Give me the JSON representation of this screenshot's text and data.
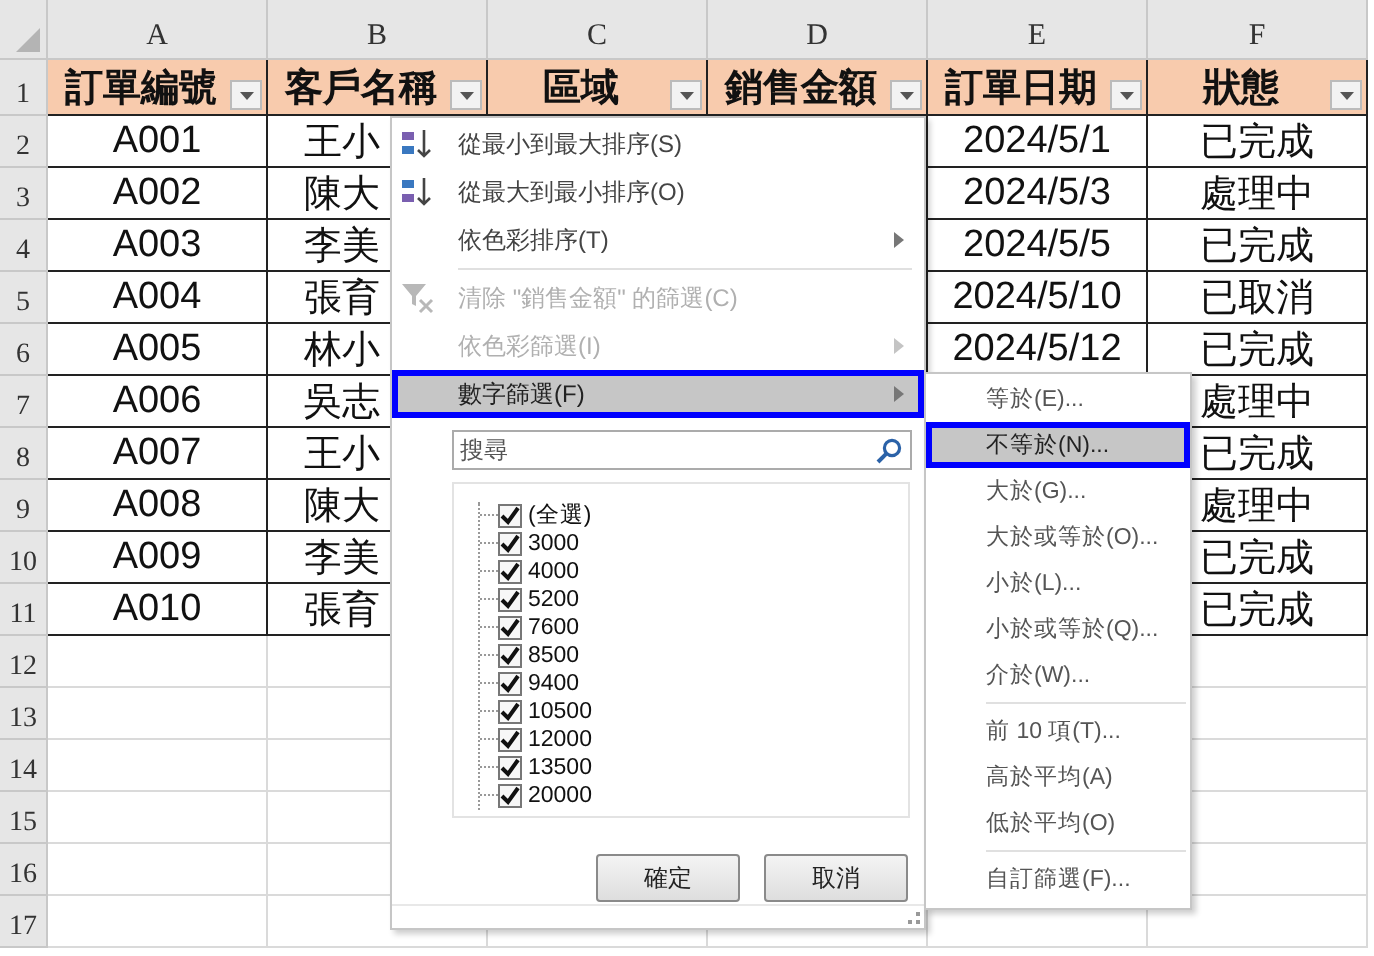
{
  "sheet": {
    "column_headers": [
      "A",
      "B",
      "C",
      "D",
      "E",
      "F"
    ],
    "row_headers": [
      "1",
      "2",
      "3",
      "4",
      "5",
      "6",
      "7",
      "8",
      "9",
      "10",
      "11",
      "12",
      "13",
      "14",
      "15",
      "16",
      "17"
    ],
    "fields": [
      {
        "label": "訂單編號"
      },
      {
        "label": "客戶名稱"
      },
      {
        "label": "區域"
      },
      {
        "label": "銷售金額"
      },
      {
        "label": "訂單日期"
      },
      {
        "label": "狀態"
      }
    ],
    "records": [
      {
        "order_id": "A001",
        "customer": "王小",
        "date": "2024/5/1",
        "status": "已完成"
      },
      {
        "order_id": "A002",
        "customer": "陳大",
        "date": "2024/5/3",
        "status": "處理中"
      },
      {
        "order_id": "A003",
        "customer": "李美",
        "date": "2024/5/5",
        "status": "已完成"
      },
      {
        "order_id": "A004",
        "customer": "張育",
        "date": "2024/5/10",
        "status": "已取消"
      },
      {
        "order_id": "A005",
        "customer": "林小",
        "date": "2024/5/12",
        "status": "已完成"
      },
      {
        "order_id": "A006",
        "customer": "吳志",
        "status": "處理中"
      },
      {
        "order_id": "A007",
        "customer": "王小",
        "status": "已完成"
      },
      {
        "order_id": "A008",
        "customer": "陳大",
        "status": "處理中"
      },
      {
        "order_id": "A009",
        "customer": "李美",
        "status": "已完成"
      },
      {
        "order_id": "A010",
        "customer": "張育",
        "status": "已完成"
      }
    ]
  },
  "filter_menu": {
    "items": [
      {
        "kind": "item",
        "label": "從最小到最大排序(S)",
        "disabled": false,
        "submenu": false,
        "selected": false
      },
      {
        "kind": "item",
        "label": "從最大到最小排序(O)",
        "disabled": false,
        "submenu": false,
        "selected": false
      },
      {
        "kind": "item",
        "label": "依色彩排序(T)",
        "disabled": false,
        "submenu": true,
        "selected": false
      },
      {
        "kind": "separator"
      },
      {
        "kind": "item",
        "label": "清除 \"銷售金額\" 的篩選(C)",
        "disabled": true,
        "submenu": false,
        "selected": false
      },
      {
        "kind": "item",
        "label": "依色彩篩選(I)",
        "disabled": true,
        "submenu": true,
        "selected": false
      },
      {
        "kind": "item",
        "label": "數字篩選(F)",
        "disabled": false,
        "submenu": true,
        "selected": true
      }
    ],
    "search": {
      "placeholder": "搜尋"
    },
    "values": [
      {
        "label": "(全選)",
        "checked": true
      },
      {
        "label": "3000",
        "checked": true
      },
      {
        "label": "4000",
        "checked": true
      },
      {
        "label": "5200",
        "checked": true
      },
      {
        "label": "7600",
        "checked": true
      },
      {
        "label": "8500",
        "checked": true
      },
      {
        "label": "9400",
        "checked": true
      },
      {
        "label": "10500",
        "checked": true
      },
      {
        "label": "12000",
        "checked": true
      },
      {
        "label": "13500",
        "checked": true
      },
      {
        "label": "20000",
        "checked": true
      }
    ],
    "buttons": [
      "確定",
      "取消"
    ]
  },
  "number_filter_submenu": {
    "items": [
      {
        "kind": "item",
        "label": "等於(E)...",
        "selected": false
      },
      {
        "kind": "item",
        "label": "不等於(N)...",
        "selected": true
      },
      {
        "kind": "item",
        "label": "大於(G)...",
        "selected": false
      },
      {
        "kind": "item",
        "label": "大於或等於(O)...",
        "selected": false
      },
      {
        "kind": "item",
        "label": "小於(L)...",
        "selected": false
      },
      {
        "kind": "item",
        "label": "小於或等於(Q)...",
        "selected": false
      },
      {
        "kind": "item",
        "label": "介於(W)...",
        "selected": false
      },
      {
        "kind": "separator"
      },
      {
        "kind": "item",
        "label": "前 10 項(T)...",
        "selected": false
      },
      {
        "kind": "item",
        "label": "高於平均(A)",
        "selected": false
      },
      {
        "kind": "item",
        "label": "低於平均(O)",
        "selected": false
      },
      {
        "kind": "separator"
      },
      {
        "kind": "item",
        "label": "自訂篩選(F)...",
        "selected": false
      }
    ]
  }
}
